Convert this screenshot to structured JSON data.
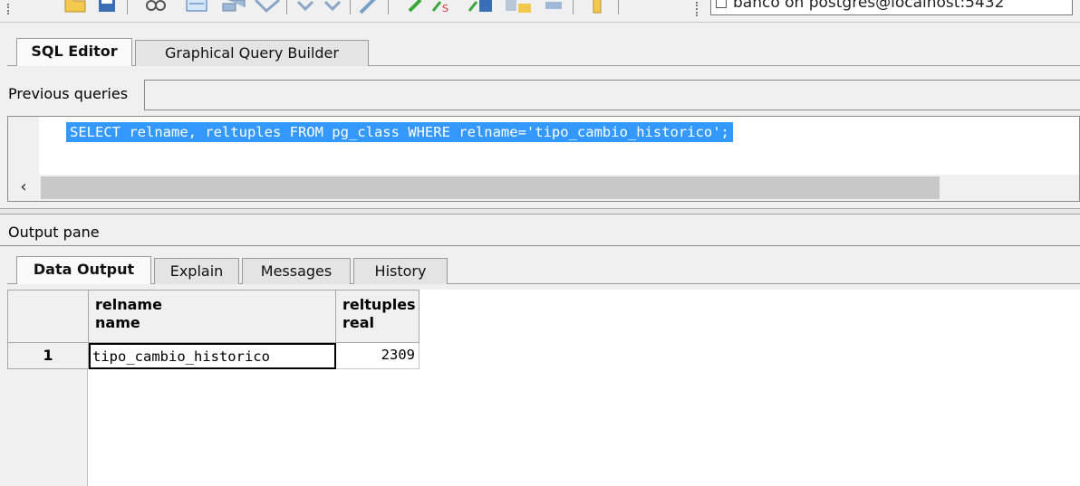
{
  "toolbar": {
    "connection": "banco on postgres@localhost:5432",
    "icons": [
      "folder-open-icon",
      "save-icon",
      "find-icon",
      "cut-icon",
      "copy-icon",
      "clear-icon",
      "undo-icon",
      "redo-icon",
      "pencil-icon",
      "execute-icon",
      "execute-pgscript-icon",
      "execute-to-file-icon",
      "explain-icon",
      "stop-icon",
      "commit-icon"
    ]
  },
  "editor_tabs": [
    {
      "label": "SQL Editor",
      "active": true
    },
    {
      "label": "Graphical Query Builder",
      "active": false
    }
  ],
  "previous_queries": {
    "label": "Previous queries",
    "value": ""
  },
  "sql": {
    "text": "SELECT relname, reltuples FROM pg_class WHERE relname='tipo_cambio_historico';"
  },
  "scroll_left_arrow": "‹",
  "output": {
    "title": "Output pane",
    "tabs": [
      {
        "label": "Data Output",
        "active": true
      },
      {
        "label": "Explain",
        "active": false
      },
      {
        "label": "Messages",
        "active": false
      },
      {
        "label": "History",
        "active": false
      }
    ],
    "columns": [
      {
        "name": "relname",
        "type": "name"
      },
      {
        "name": "reltuples",
        "type": "real"
      }
    ],
    "rows": [
      {
        "num": "1",
        "relname": "tipo_cambio_historico",
        "reltuples": "2309"
      }
    ]
  },
  "colors": {
    "selection": "#3399ff",
    "background": "#f0f0f0"
  }
}
